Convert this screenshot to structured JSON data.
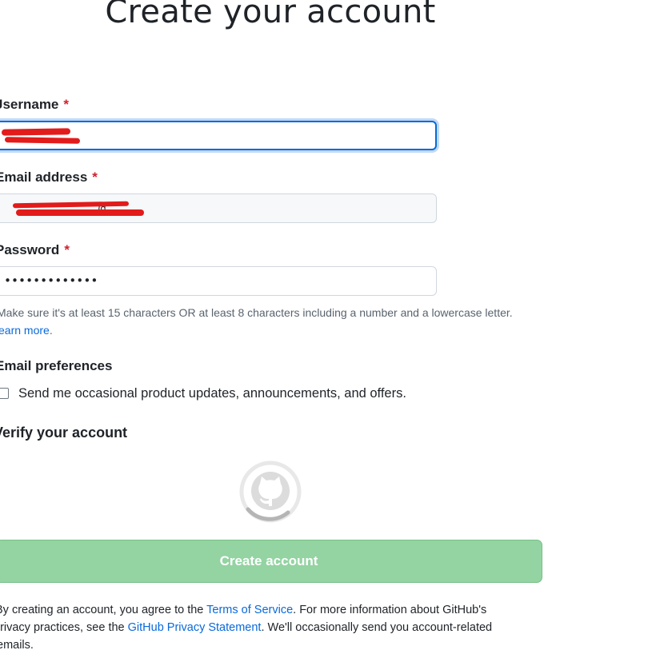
{
  "page": {
    "title": "Create your account"
  },
  "form": {
    "username": {
      "label": "Jsername",
      "required": "*",
      "value": ""
    },
    "email": {
      "label": "Email address",
      "required": "*",
      "value": "@"
    },
    "password": {
      "label": "Password",
      "required": "*",
      "value": "•••••••••••••"
    },
    "password_hint": "Make sure it's at least 15 characters OR at least 8 characters including a number and a lowercase letter.",
    "learn_more": "earn more",
    "learn_more_suffix": ".",
    "email_preferences": {
      "heading": "Email preferences",
      "checkbox_label": "Send me occasional product updates, announcements, and offers.",
      "checked": false
    },
    "verify": {
      "heading": "Verify your account",
      "state": "loading"
    },
    "submit_label": "Create account",
    "legal": {
      "prefix": "By creating an account, you agree to the",
      "terms_link": "Terms of Service",
      "middle": ". For more information about GitHub's",
      "line2_prefix": "privacy practices, see the",
      "privacy_link": "GitHub Privacy Statement",
      "line2_suffix": ". We'll occasionally send you account-related",
      "line3": "emails."
    }
  },
  "colors": {
    "accent": "#0969da",
    "required": "#cf222e",
    "button_disabled": "#94d3a2",
    "redaction": "#e21b1b"
  }
}
